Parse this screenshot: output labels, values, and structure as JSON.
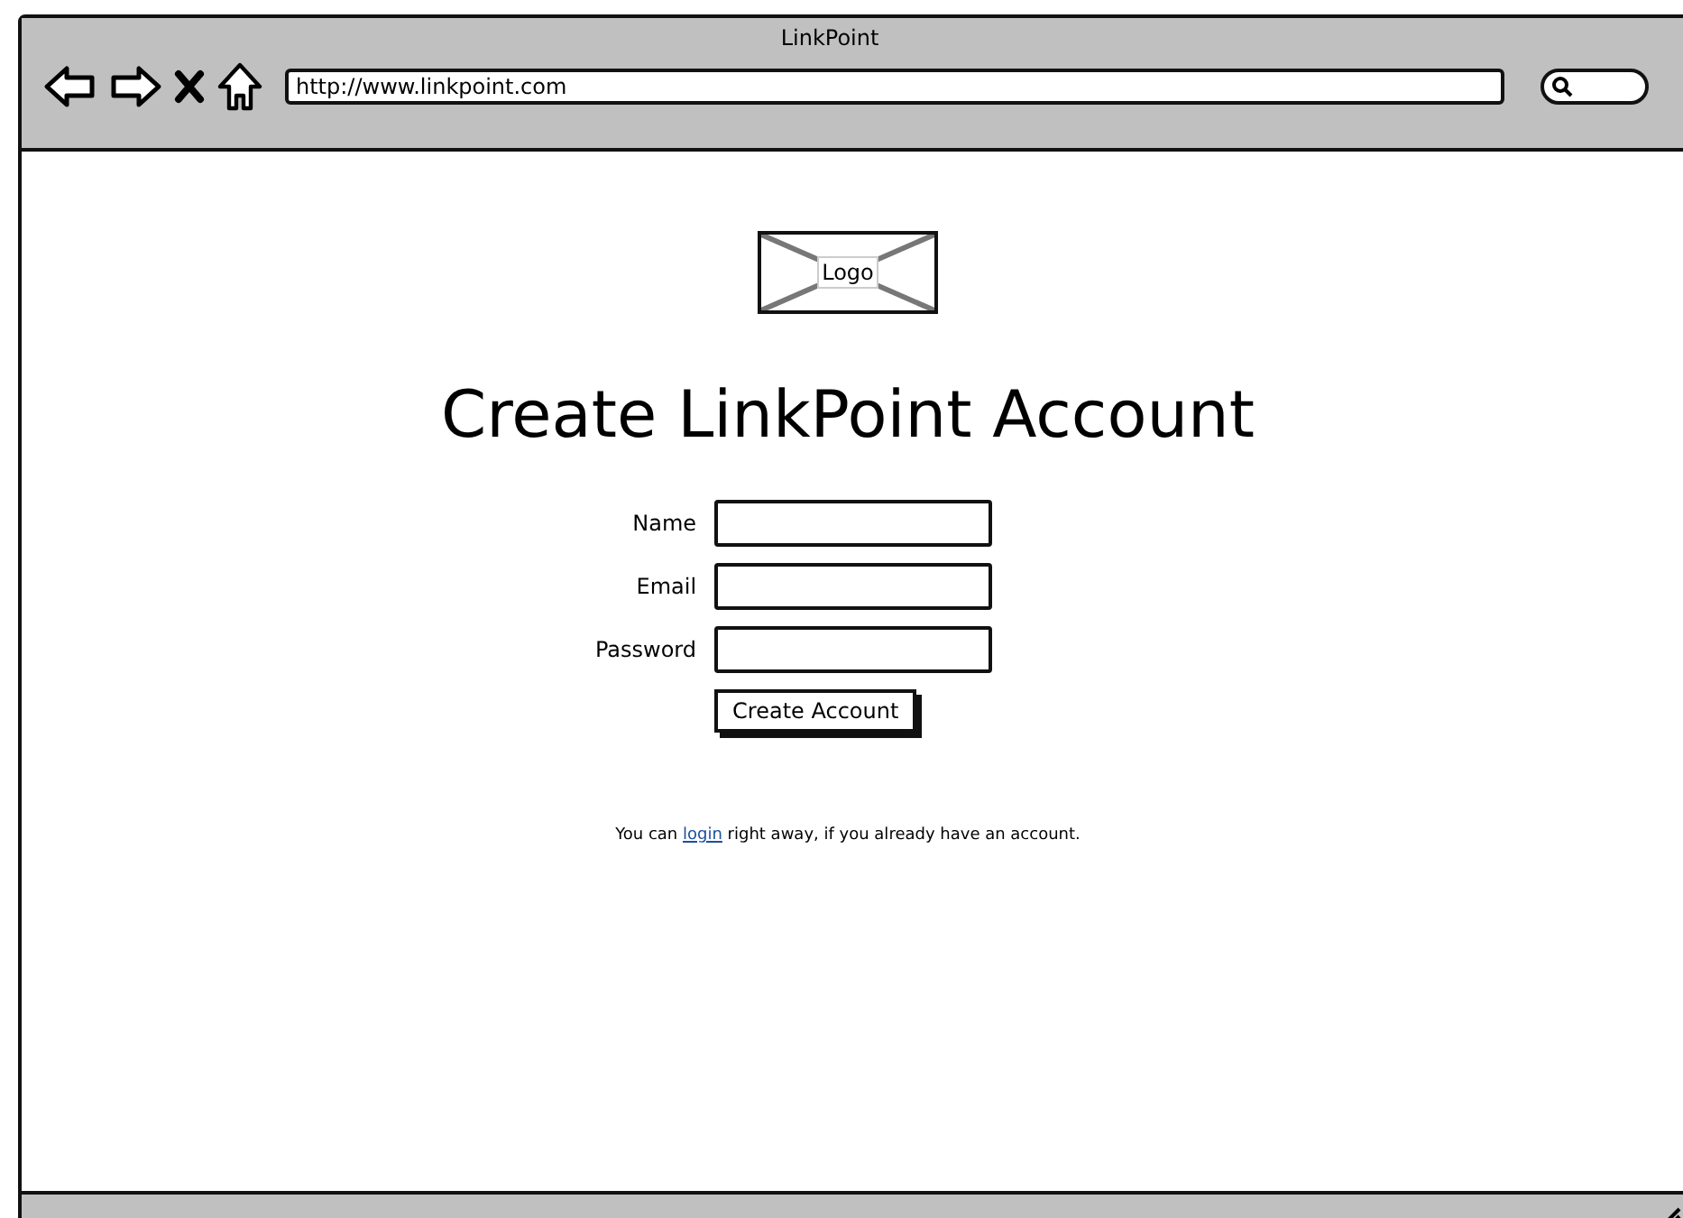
{
  "window": {
    "title": "LinkPoint"
  },
  "address_bar": {
    "value": "http://www.linkpoint.com"
  },
  "logo": {
    "label": "Logo"
  },
  "heading": "Create LinkPoint Account",
  "fields": [
    {
      "label": "Name"
    },
    {
      "label": "Email"
    },
    {
      "label": "Password"
    }
  ],
  "submit_button": "Create Account",
  "login_note": {
    "before": "You can ",
    "link": "login",
    "after": " right away, if you already have an account."
  }
}
